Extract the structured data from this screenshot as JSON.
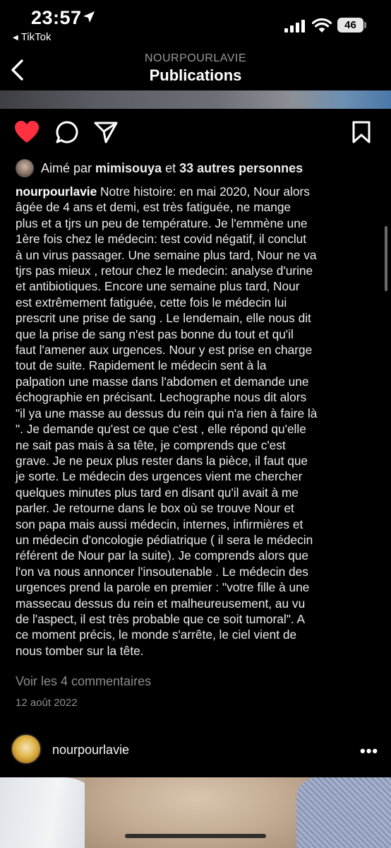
{
  "status_bar": {
    "time": "23:57",
    "back_app": "TikTok",
    "battery": "46"
  },
  "header": {
    "subtitle": "NOURPOURLAVIE",
    "title": "Publications"
  },
  "actions": {
    "liked": true,
    "like_color": "#ff3040"
  },
  "likes": {
    "prefix": "Aimé par",
    "user": "mimisouya",
    "middle": "et",
    "others": "33 autres personnes"
  },
  "caption": {
    "author": "nourpourlavie",
    "lines": [
      " Notre histoire: en mai 2020, Nour alors",
      "âgée de 4 ans et demi,  est très fatiguée,  ne mange",
      "plus et a tjrs un peu de température.  Je l'emmène une",
      "1ère fois chez le médecin: test covid négatif,  il conclut",
      "à un virus passager. Une semaine plus tard, Nour ne va",
      "tjrs pas mieux , retour chez le medecin: analyse d'urine",
      "et antibiotiques.  Encore une semaine plus tard,  Nour",
      "est extrêmement fatiguée,  cette fois le médecin lui",
      "prescrit une prise de sang . Le lendemain,  elle nous dit",
      "que la prise de sang n'est pas bonne du tout et qu'il",
      "faut l'amener aux urgences.  Nour y est prise en charge",
      "tout de suite. Rapidement le médecin sent à la",
      "palpation une masse dans l'abdomen et demande une",
      "échographie en précisant. Lechographe nous dit alors",
      "\"il ya une masse au dessus du rein qui n'a rien à faire là",
      "\". Je demande qu'est ce que c'est , elle répond qu'elle",
      "ne sait pas mais à sa tête,  je comprends que c'est",
      "grave. Je ne peux plus rester dans la pièce, il faut que",
      "je sorte. Le médecin des urgences vient me chercher",
      "quelques minutes plus tard en disant qu'il avait à me",
      "parler.  Je retourne dans le box où se trouve Nour et",
      "son papa  mais aussi médecin,  internes,  infirmières et",
      "un médecin d'oncologie pédiatrique ( il sera le médecin",
      "référent de Nour par la suite). Je comprends alors que",
      "l'on va nous annoncer l'insoutenable . Le médecin des",
      "urgences prend la parole en premier : \"votre fille à une",
      "massecau dessus du rein et malheureusement,  au vu",
      "de l'aspect,  il est très probable que ce soit tumoral\". A",
      "ce moment précis,  le monde s'arrête,  le ciel vient de",
      "nous tomber sur la tête."
    ]
  },
  "comments_link": "Voir les 4 commentaires",
  "post_date": "12 août 2022",
  "next_post": {
    "username": "nourpourlavie",
    "more": "•••"
  }
}
